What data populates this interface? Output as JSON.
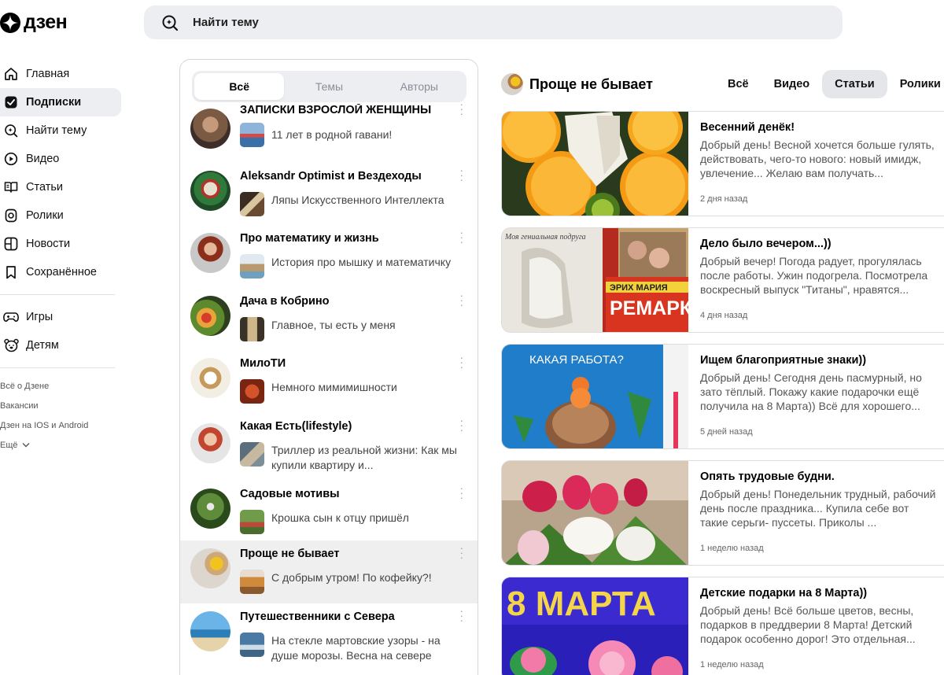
{
  "app": {
    "logo_text": "дзен"
  },
  "search": {
    "placeholder": "Найти тему"
  },
  "nav": {
    "items": [
      {
        "label": "Главная",
        "icon": "home-icon"
      },
      {
        "label": "Подписки",
        "icon": "subscriptions-icon",
        "active": true
      },
      {
        "label": "Найти тему",
        "icon": "find-topic-icon"
      },
      {
        "label": "Видео",
        "icon": "video-icon"
      },
      {
        "label": "Статьи",
        "icon": "articles-icon"
      },
      {
        "label": "Ролики",
        "icon": "clips-icon"
      },
      {
        "label": "Новости",
        "icon": "news-icon"
      },
      {
        "label": "Сохранённое",
        "icon": "bookmark-icon"
      }
    ],
    "items2": [
      {
        "label": "Игры",
        "icon": "gamepad-icon"
      },
      {
        "label": "Детям",
        "icon": "bear-icon"
      }
    ],
    "footer": [
      "Всё о Дзене",
      "Вакансии",
      "Дзен на IOS и Android",
      "Ещё"
    ]
  },
  "subs": {
    "tabs": [
      "Всё",
      "Темы",
      "Авторы"
    ],
    "items": [
      {
        "name": "ЗАПИСКИ ВЗРОСЛОЙ ЖЕНЩИНЫ",
        "title": "11 лет в родной гавани!"
      },
      {
        "name": "Aleksandr Optimist и Вездеходы",
        "title": "Ляпы Искусственного Интеллекта"
      },
      {
        "name": "Про математику и жизнь",
        "title": "История про мышку и математичку"
      },
      {
        "name": "Дача в Кобрино",
        "title": "Главное, ты есть у меня"
      },
      {
        "name": "МилоТИ",
        "title": "Немного мимимишности"
      },
      {
        "name": "Какая Есть(lifestyle)",
        "title": "Триллер из реальной жизни: Как мы купили квартиру и..."
      },
      {
        "name": "Садовые мотивы",
        "title": "Крошка сын к отцу пришёл"
      },
      {
        "name": "Проще не бывает",
        "title": "С добрым утром! По кофейку?!",
        "highlight": true
      },
      {
        "name": "Путешественники с Севера",
        "title": "На стекле мартовские узоры - на душе морозы. Весна на севере"
      }
    ]
  },
  "channel": {
    "name": "Проще не бывает",
    "tabs": [
      "Всё",
      "Видео",
      "Статьи",
      "Ролики"
    ],
    "active_tab": "Статьи"
  },
  "cards": [
    {
      "title": "Весенний денёк!",
      "text": "Добрый день! Весной хочется больше гулять, действовать, чего-то нового: новый имидж, увлечение... Желаю вам получать...",
      "date": "2 дня назад"
    },
    {
      "title": "Дело было вечером...))",
      "text": "Добрый вечер! Погода радует, прогулялась после работы. Ужин подогрела. Посмотрела воскресный выпуск \"Титаны\", нравятся...",
      "date": "4 дня назад",
      "img_text_top": "Моя гениальная подруга",
      "img_text_book": "ЭРИХ МАРИЯ",
      "img_text_book2": "РЕМАРК"
    },
    {
      "title": "Ищем благоприятные знаки))",
      "text": "Добрый день! Сегодня день пасмурный, но зато тёплый. Покажу какие подарочки ещё получила на 8 Марта)) Всё для хорошего...",
      "date": "5 дней назад",
      "img_text": "КАКАЯ РАБОТА?"
    },
    {
      "title": "Опять трудовые будни.",
      "text": "Добрый день! Понедельник трудный, рабочий день после праздника... Купила себе вот такие серьги- пуссеты. Приколы ...",
      "date": "1 неделю назад"
    },
    {
      "title": "Детские подарки на 8 Марта))",
      "text": "Добрый день! Всё больше цветов, весны, подарков в преддверии 8 Марта! Детский подарок особенно дорог! Это отдельная...",
      "date": "1 неделю назад",
      "img_text": "8 МАРТА"
    }
  ]
}
